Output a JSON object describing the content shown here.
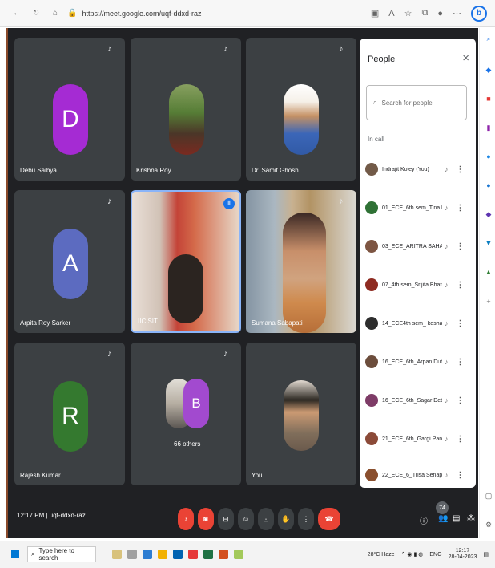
{
  "browser": {
    "url": "https://meet.google.com/uqf-ddxd-raz"
  },
  "tiles": [
    {
      "id": "debu",
      "name": "Debu Saibya",
      "initial": "D",
      "color": "#a52bd3"
    },
    {
      "id": "krishna",
      "name": "Krishna Roy"
    },
    {
      "id": "samit",
      "name": "Dr. Samit Ghosh"
    },
    {
      "id": "arpita",
      "name": "Arpita Roy Sarker",
      "initial": "A",
      "color": "#5c6bc0"
    },
    {
      "id": "iic",
      "name": "IIC SIT"
    },
    {
      "id": "sumana",
      "name": "Sumana Sabapati"
    },
    {
      "id": "rajesh",
      "name": "Rajesh Kumar",
      "initial": "R",
      "color": "#34792f"
    },
    {
      "id": "others",
      "name": "66 others",
      "initial": "B",
      "color": "#a24acf"
    },
    {
      "id": "you",
      "name": "You"
    }
  ],
  "people_panel": {
    "title": "People",
    "search_placeholder": "Search for people",
    "section": "In call",
    "participants": [
      "Indrajit Koley (You)",
      "01_ECE_6th sem_Tina Dal...",
      "03_ECE_ARITRA SAHA",
      "07_4th sem_Srijita Bhatta...",
      "14_ECE4th sem_ keshav",
      "16_ECE_6th_Arpan Dutta",
      "16_ECE_6th_Sagar Debna...",
      "21_ECE_6th_Gargi Pandit",
      "22_ECE_6_Trisa Senapati..."
    ]
  },
  "meeting": {
    "time": "12:17 PM",
    "code": "uqf-ddxd-raz",
    "participant_count": "74"
  },
  "taskbar": {
    "search_placeholder": "Type here to search",
    "weather": "28°C Haze",
    "lang": "ENG",
    "clock_time": "12:17",
    "clock_date": "28-04-2023"
  }
}
